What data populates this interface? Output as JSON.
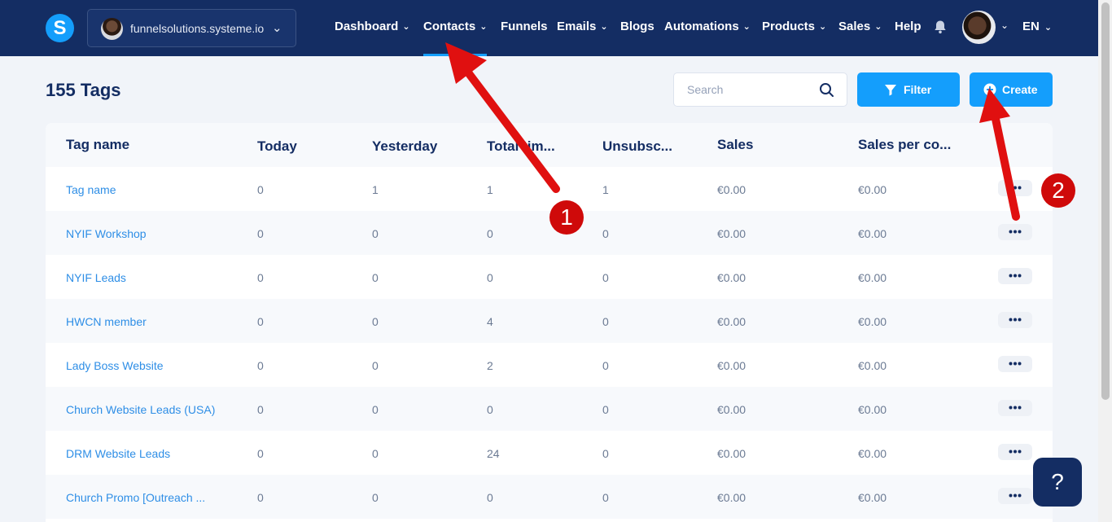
{
  "app": {
    "logo_letter": "S",
    "workspace_name": "funnelsolutions.systeme.io"
  },
  "nav": {
    "items": [
      {
        "label": "Dashboard",
        "has_menu": true
      },
      {
        "label": "Contacts",
        "has_menu": true,
        "active": true
      },
      {
        "label": "Funnels",
        "has_menu": false
      },
      {
        "label": "Emails",
        "has_menu": true
      },
      {
        "label": "Blogs",
        "has_menu": false
      },
      {
        "label": "Automations",
        "has_menu": true
      },
      {
        "label": "Products",
        "has_menu": true
      },
      {
        "label": "Sales",
        "has_menu": true
      },
      {
        "label": "Help",
        "has_menu": false
      }
    ],
    "language": "EN",
    "icons": [
      "bell-icon",
      "user-avatar",
      "chevron-down-icon"
    ]
  },
  "page": {
    "title": "155 Tags"
  },
  "toolbar": {
    "search_placeholder": "Search",
    "filter_label": "Filter",
    "create_label": "Create"
  },
  "table": {
    "headers": [
      "Tag name",
      "Today",
      "Yesterday",
      "Total tim...",
      "Unsubsc...",
      "Sales",
      "Sales per co..."
    ],
    "rows": [
      {
        "name": "Tag name",
        "today": "0",
        "yesterday": "1",
        "total": "1",
        "unsub": "1",
        "sales": "€0.00",
        "per": "€0.00"
      },
      {
        "name": "NYIF Workshop",
        "today": "0",
        "yesterday": "0",
        "total": "0",
        "unsub": "0",
        "sales": "€0.00",
        "per": "€0.00"
      },
      {
        "name": "NYIF Leads",
        "today": "0",
        "yesterday": "0",
        "total": "0",
        "unsub": "0",
        "sales": "€0.00",
        "per": "€0.00"
      },
      {
        "name": "HWCN member",
        "today": "0",
        "yesterday": "0",
        "total": "4",
        "unsub": "0",
        "sales": "€0.00",
        "per": "€0.00"
      },
      {
        "name": "Lady Boss Website",
        "today": "0",
        "yesterday": "0",
        "total": "2",
        "unsub": "0",
        "sales": "€0.00",
        "per": "€0.00"
      },
      {
        "name": "Church Website Leads (USA)",
        "today": "0",
        "yesterday": "0",
        "total": "0",
        "unsub": "0",
        "sales": "€0.00",
        "per": "€0.00"
      },
      {
        "name": "DRM Website Leads",
        "today": "0",
        "yesterday": "0",
        "total": "24",
        "unsub": "0",
        "sales": "€0.00",
        "per": "€0.00"
      },
      {
        "name": "Church Promo [Outreach ...",
        "today": "0",
        "yesterday": "0",
        "total": "0",
        "unsub": "0",
        "sales": "€0.00",
        "per": "€0.00"
      }
    ]
  },
  "help_button": "?",
  "annotations": {
    "badge_1": "1",
    "badge_2": "2",
    "color": "#e01010"
  },
  "colors": {
    "topbar": "#142d63",
    "accent": "#149efc",
    "link": "#2e8ee6",
    "background": "#f1f4f9"
  }
}
